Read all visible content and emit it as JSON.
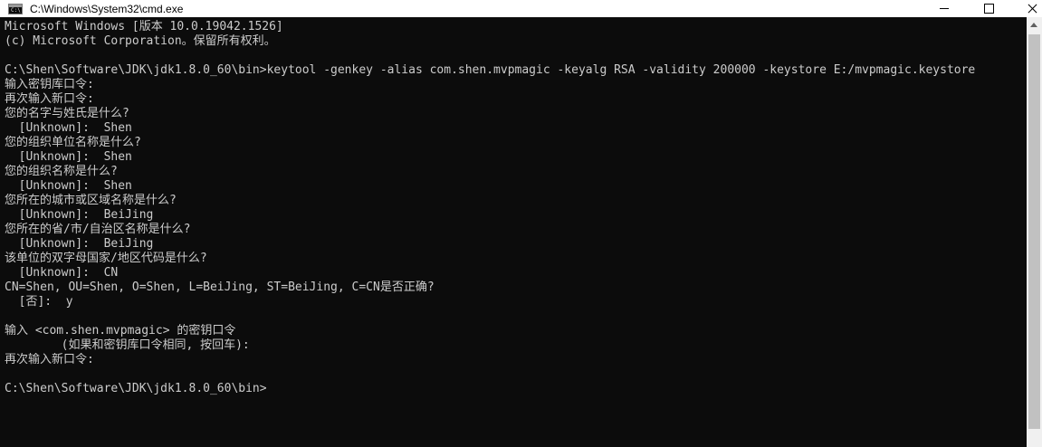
{
  "window": {
    "title": "C:\\Windows\\System32\\cmd.exe",
    "app_icon": "cmd-icon",
    "app_icon_glyph": "C:\\"
  },
  "controls": {
    "minimize": "minimize-icon",
    "maximize": "maximize-icon",
    "close": "close-icon"
  },
  "console": {
    "lines": [
      "Microsoft Windows [版本 10.0.19042.1526]",
      "(c) Microsoft Corporation。保留所有权利。",
      "",
      "C:\\Shen\\Software\\JDK\\jdk1.8.0_60\\bin>keytool -genkey -alias com.shen.mvpmagic -keyalg RSA -validity 200000 -keystore E:/mvpmagic.keystore",
      "输入密钥库口令:",
      "再次输入新口令:",
      "您的名字与姓氏是什么?",
      "  [Unknown]:  Shen",
      "您的组织单位名称是什么?",
      "  [Unknown]:  Shen",
      "您的组织名称是什么?",
      "  [Unknown]:  Shen",
      "您所在的城市或区域名称是什么?",
      "  [Unknown]:  BeiJing",
      "您所在的省/市/自治区名称是什么?",
      "  [Unknown]:  BeiJing",
      "该单位的双字母国家/地区代码是什么?",
      "  [Unknown]:  CN",
      "CN=Shen, OU=Shen, O=Shen, L=BeiJing, ST=BeiJing, C=CN是否正确?",
      "  [否]:  y",
      "",
      "输入 <com.shen.mvpmagic> 的密钥口令",
      "        (如果和密钥库口令相同, 按回车):",
      "再次输入新口令:",
      "",
      "C:\\Shen\\Software\\JDK\\jdk1.8.0_60\\bin>"
    ]
  },
  "scrollbar": {
    "arrow_up_icon": "scroll-up-arrow-icon"
  }
}
